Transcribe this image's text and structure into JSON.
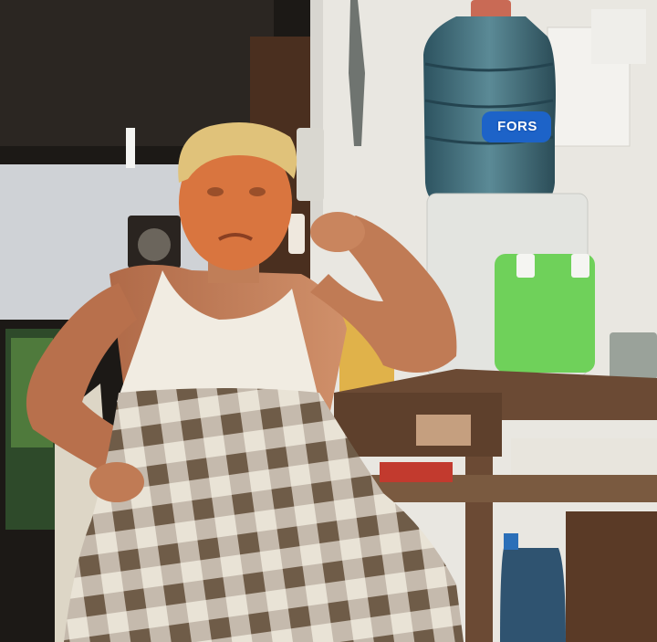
{
  "image": {
    "bottle_label": "FORS"
  },
  "colors": {
    "wall": "#e9e7e1",
    "dark_room": "#2b2622",
    "wood_door": "#5a3a26",
    "desk_wood": "#6b4a34",
    "water_bottle": "#3f6b78",
    "dispenser_body": "#e3e4e0",
    "dispenser_tray": "#6fd15a",
    "skin": "#c9805a",
    "face": "#d9753f",
    "hair": "#e0c27a",
    "tank_top": "#f1ece2",
    "sarong_light": "#e9e3d6",
    "sarong_dark": "#7a6651"
  }
}
